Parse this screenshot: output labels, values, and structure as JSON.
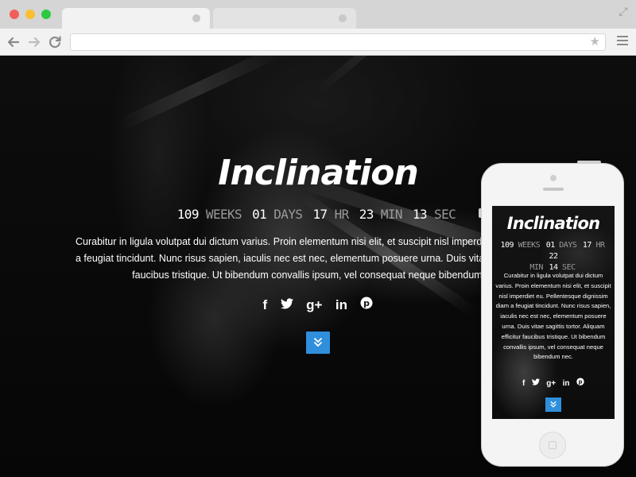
{
  "browser": {
    "tabs": [
      {
        "label": "",
        "active": true
      },
      {
        "label": "",
        "active": false
      }
    ],
    "url": "",
    "icons": [
      "back-arrow-icon",
      "forward-arrow-icon",
      "reload-icon",
      "star-icon",
      "hamburger-menu-icon",
      "fullscreen-icon"
    ]
  },
  "hero": {
    "title": "Inclination",
    "countdown": [
      {
        "value": "109",
        "unit": "WEEKS"
      },
      {
        "value": "01",
        "unit": "DAYS"
      },
      {
        "value": "17",
        "unit": "HR"
      },
      {
        "value": "23",
        "unit": "MIN"
      },
      {
        "value": "13",
        "unit": "SEC"
      }
    ],
    "text_lines": [
      "Curabitur in ligula volutpat dui dictum varius. Proin elementum nisi elit, et suscipit nisl imperdiet eu. Pellentesque dignissim diam",
      "a feugiat tincidunt. Nunc risus sapien, iaculis nec est nec, elementum posuere urna. Duis vitae sagittis tortor. Aliquam efficitur",
      "faucibus tristique. Ut bibendum convallis ipsum, vel consequat neque bibendum nec."
    ],
    "social": [
      {
        "name": "facebook",
        "glyph": "f"
      },
      {
        "name": "twitter",
        "glyph": "🐦"
      },
      {
        "name": "google-plus",
        "glyph": "g+"
      },
      {
        "name": "linkedin",
        "glyph": "in"
      },
      {
        "name": "pinterest",
        "glyph": "℗"
      }
    ],
    "scroll_icon": "double-chevron-down-icon"
  },
  "phone": {
    "title": "Inclination",
    "countdown_line1": [
      {
        "value": "109",
        "unit": "WEEKS"
      },
      {
        "value": "01",
        "unit": "DAYS"
      },
      {
        "value": "17",
        "unit": "HR"
      },
      {
        "value": "22",
        "unit": ""
      }
    ],
    "countdown_line2": [
      {
        "value": "",
        "unit": "MIN"
      },
      {
        "value": "14",
        "unit": "SEC"
      }
    ],
    "text_lines": [
      "Curabitur in ligula volutpat dui dictum",
      "varius. Proin elementum nisi elit, et suscipit",
      "nisl imperdiet eu. Pellentesque dignissim",
      "diam a feugiat tincidunt. Nunc risus sapien,",
      "iaculis nec est nec, elementum posuere",
      "urna. Duis vitae sagittis tortor. Aliquam",
      "efficitur faucibus tristique. Ut bibendum",
      "convallis ipsum, vel consequat neque",
      "bibendum nec."
    ],
    "social": [
      {
        "name": "facebook",
        "glyph": "f"
      },
      {
        "name": "twitter",
        "glyph": "🐦"
      },
      {
        "name": "google-plus",
        "glyph": "g+"
      },
      {
        "name": "linkedin",
        "glyph": "in"
      },
      {
        "name": "pinterest",
        "glyph": "℗"
      }
    ],
    "accent": "#2f8fdc"
  }
}
